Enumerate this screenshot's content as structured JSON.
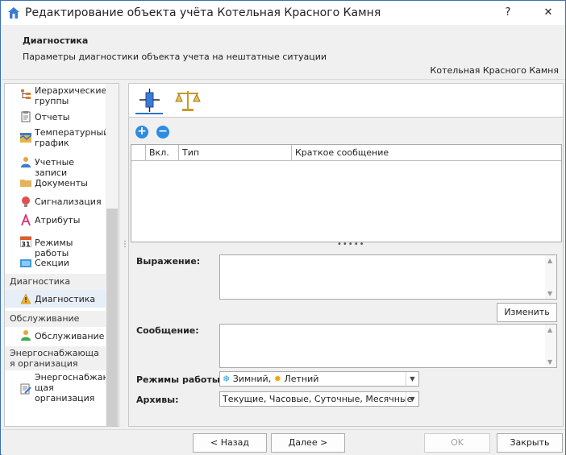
{
  "window": {
    "title": "Редактирование объекта учёта Котельная Красного Камня",
    "help_label": "?",
    "close_label": "✕"
  },
  "header": {
    "title": "Диагностика",
    "subtitle": "Параметры диагностики объекта учета на нештатные ситуации",
    "object_name": "Котельная Красного Камня"
  },
  "sidebar": {
    "items": [
      {
        "label": "Иерархические группы",
        "icon": "hierarchy-icon"
      },
      {
        "label": "Отчеты",
        "icon": "report-icon"
      },
      {
        "label": "Температурный график",
        "icon": "temperature-chart-icon"
      },
      {
        "label": "Учетные записи",
        "icon": "user-icon"
      },
      {
        "label": "Документы",
        "icon": "folder-icon"
      },
      {
        "label": "Сигнализация",
        "icon": "alarm-icon"
      },
      {
        "label": "Атрибуты",
        "icon": "attribute-icon"
      },
      {
        "label": "Режимы работы",
        "icon": "calendar-icon",
        "calendar_number": "31"
      },
      {
        "label": "Секции",
        "icon": "section-icon"
      }
    ],
    "groups": [
      {
        "title": "Диагностика",
        "items": [
          {
            "label": "Диагностика",
            "icon": "warning-icon",
            "selected": true
          }
        ]
      },
      {
        "title": "Обслуживание",
        "items": [
          {
            "label": "Обслуживание",
            "icon": "service-person-icon"
          }
        ]
      },
      {
        "title": "Энергоснабжающая организация",
        "items": [
          {
            "label": "Энергоснабжающая организация",
            "icon": "contract-icon"
          }
        ]
      }
    ],
    "group_titles_display": [
      "Энергоснабжающа",
      "я организация"
    ],
    "energy_item_display": [
      "Энергоснабжаю",
      "щая",
      "организация"
    ],
    "hier_display": [
      "Иерархические",
      "группы"
    ],
    "temp_display": [
      "Температурный",
      "график"
    ]
  },
  "tabs": [
    {
      "name": "diagnostics-tab",
      "icon": "diagnostics-icon",
      "active": true
    },
    {
      "name": "balance-tab",
      "icon": "scales-icon",
      "active": false
    }
  ],
  "grid": {
    "columns": [
      "",
      "Вкл.",
      "Тип",
      "Краткое сообщение"
    ],
    "rows": []
  },
  "form": {
    "expression_label": "Выражение:",
    "expression_value": "",
    "change_button": "Изменить",
    "message_label": "Сообщение:",
    "message_value": "",
    "modes_label": "Режимы работы:",
    "modes_value_winter": "Зимний,",
    "modes_value_summer": "Летний",
    "archives_label": "Архивы:",
    "archives_value": "Текущие, Часовые, Суточные, Месячные"
  },
  "footer": {
    "back": "< Назад",
    "next": "Далее >",
    "ok": "OK",
    "close": "Закрыть"
  },
  "colors": {
    "accent": "#2e75c9",
    "selected_bg": "#e6eef8",
    "window_border": "#3c6fb6"
  }
}
